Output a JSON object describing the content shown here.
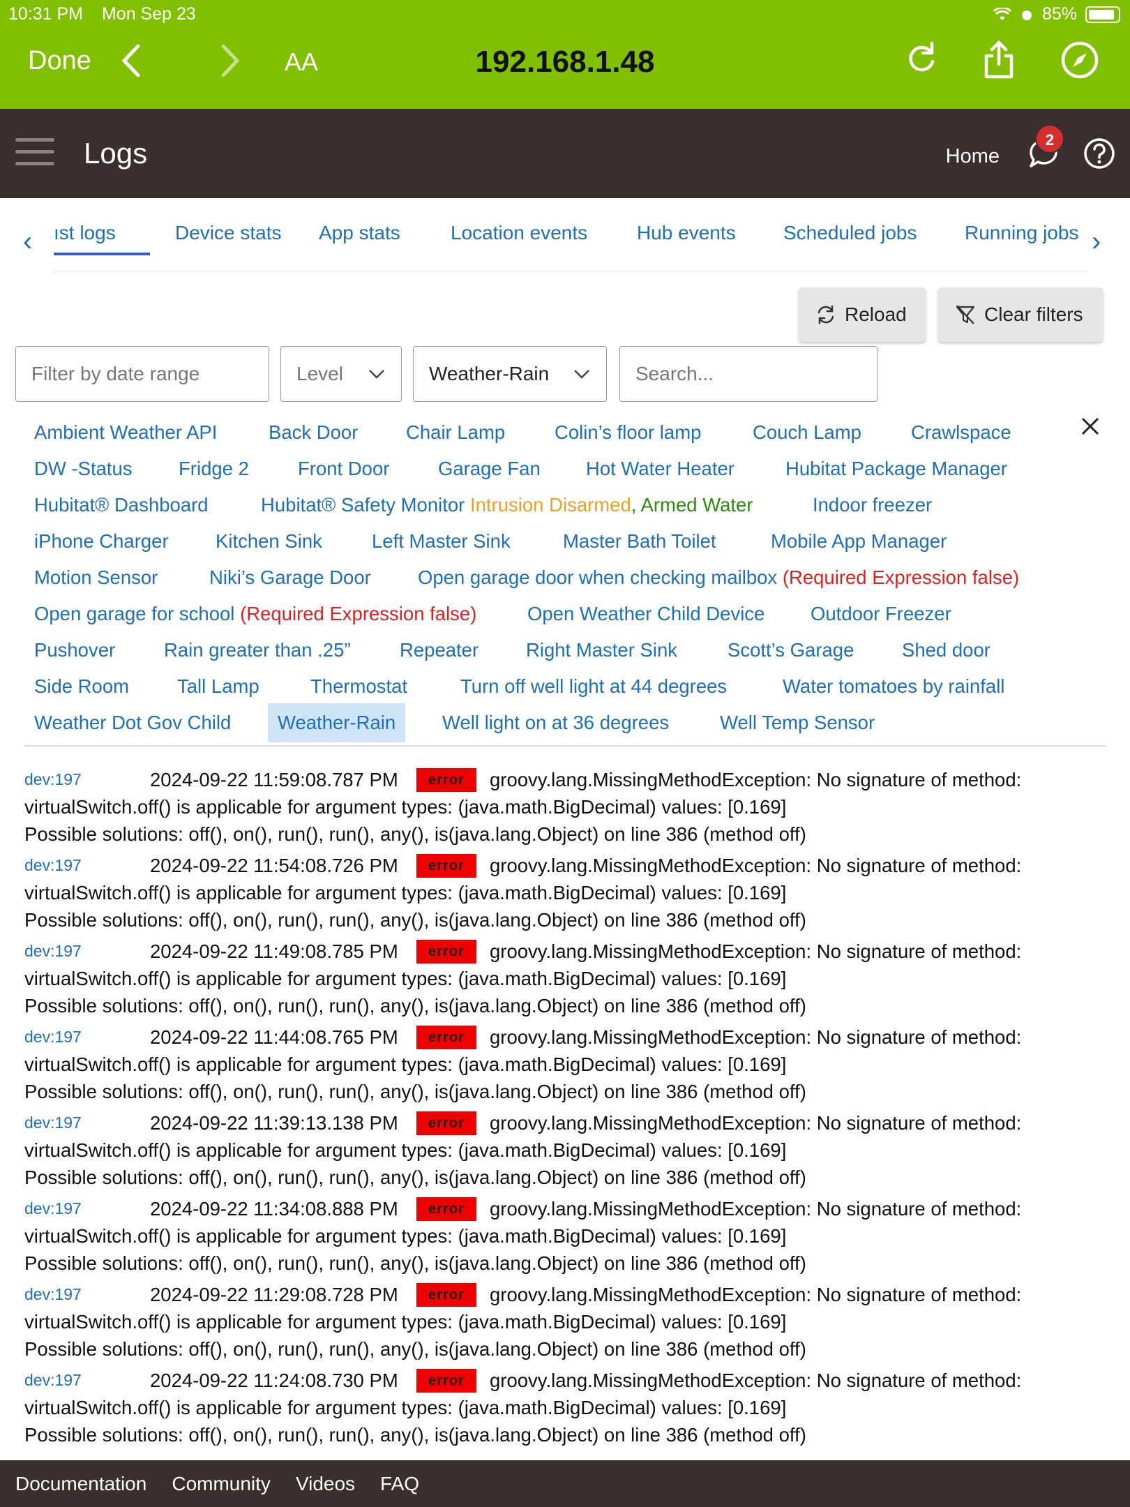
{
  "status_bar": {
    "time": "10:31 PM",
    "date": "Mon Sep 23",
    "battery": "85%"
  },
  "safari": {
    "done_label": "Done",
    "text_size_label": "AA",
    "url": "192.168.1.48"
  },
  "header": {
    "title": "Logs",
    "home_label": "Home",
    "notification_count": "2"
  },
  "tabs": [
    {
      "label": "ıst logs",
      "active": true
    },
    {
      "label": "Device stats"
    },
    {
      "label": "App stats"
    },
    {
      "label": "Location events"
    },
    {
      "label": "Hub events"
    },
    {
      "label": "Scheduled jobs"
    },
    {
      "label": "Running jobs"
    }
  ],
  "actions": {
    "reload_label": "Reload",
    "clear_label": "Clear filters"
  },
  "filters": {
    "date_placeholder": "Filter by date range",
    "level_placeholder": "Level",
    "device_value": "Weather-Rain",
    "search_placeholder": "Search..."
  },
  "devices": {
    "ambient": "Ambient Weather API",
    "back_door": "Back Door",
    "chair_lamp": "Chair Lamp",
    "colins_lamp": "Colin’s floor lamp",
    "couch_lamp": "Couch Lamp",
    "crawlspace": "Crawlspace",
    "dw_status": "DW -Status",
    "fridge2": "Fridge 2",
    "front_door": "Front Door",
    "garage_fan": "Garage Fan",
    "hot_water": "Hot Water Heater",
    "pkg_mgr": "Hubitat Package Manager",
    "dashboard": "Hubitat® Dashboard",
    "hsm": "Hubitat® Safety Monitor",
    "hsm_intrusion": "Intrusion Disarmed",
    "hsm_sep": ",",
    "hsm_water": "Armed Water",
    "indoor_freezer": "Indoor freezer",
    "iphone_charger": "iPhone Charger",
    "kitchen_sink": "Kitchen Sink",
    "left_master_sink": "Left Master Sink",
    "master_bath_toilet": "Master Bath Toilet",
    "mobile_app_mgr": "Mobile App Manager",
    "motion_sensor": "Motion Sensor",
    "nikis_garage": "Niki’s Garage Door",
    "open_garage_mailbox": "Open garage door when checking mailbox",
    "open_garage_mailbox_status": "(Required Expression false)",
    "open_garage_school": "Open garage for school",
    "open_garage_school_status": "(Required Expression false)",
    "owm_child": "Open Weather Child Device",
    "outdoor_freezer": "Outdoor Freezer",
    "pushover": "Pushover",
    "rain_gt": "Rain greater than .25”",
    "repeater": "Repeater",
    "right_master_sink": "Right Master Sink",
    "scotts_garage": "Scott’s Garage",
    "shed_door": "Shed door",
    "side_room": "Side Room",
    "tall_lamp": "Tall Lamp",
    "thermostat": "Thermostat",
    "well_off_44": "Turn off well light at 44 degrees",
    "water_tomatoes": "Water tomatoes by rainfall",
    "wdg_child": "Weather Dot Gov Child",
    "weather_rain": "Weather-Rain",
    "well_on_36": "Well light on at 36 degrees",
    "well_temp": "Well Temp Sensor"
  },
  "logs": [
    {
      "dev": "dev:197",
      "time": "2024-09-22 11:59:08.787 PM",
      "level": "error",
      "line1": "groovy.lang.MissingMethodException: No signature of method:",
      "line2": "virtualSwitch.off() is applicable for argument types: (java.math.BigDecimal) values: [0.169]",
      "line3": "Possible solutions: off(), on(), run(), run(), any(), is(java.lang.Object) on line 386 (method off)"
    },
    {
      "dev": "dev:197",
      "time": "2024-09-22 11:54:08.726 PM",
      "level": "error",
      "line1": "groovy.lang.MissingMethodException: No signature of method:",
      "line2": "virtualSwitch.off() is applicable for argument types: (java.math.BigDecimal) values: [0.169]",
      "line3": "Possible solutions: off(), on(), run(), run(), any(), is(java.lang.Object) on line 386 (method off)"
    },
    {
      "dev": "dev:197",
      "time": "2024-09-22 11:49:08.785 PM",
      "level": "error",
      "line1": "groovy.lang.MissingMethodException: No signature of method:",
      "line2": "virtualSwitch.off() is applicable for argument types: (java.math.BigDecimal) values: [0.169]",
      "line3": "Possible solutions: off(), on(), run(), run(), any(), is(java.lang.Object) on line 386 (method off)"
    },
    {
      "dev": "dev:197",
      "time": "2024-09-22 11:44:08.765 PM",
      "level": "error",
      "line1": "groovy.lang.MissingMethodException: No signature of method:",
      "line2": "virtualSwitch.off() is applicable for argument types: (java.math.BigDecimal) values: [0.169]",
      "line3": "Possible solutions: off(), on(), run(), run(), any(), is(java.lang.Object) on line 386 (method off)"
    },
    {
      "dev": "dev:197",
      "time": "2024-09-22 11:39:13.138 PM",
      "level": "error",
      "line1": "groovy.lang.MissingMethodException: No signature of method:",
      "line2": "virtualSwitch.off() is applicable for argument types: (java.math.BigDecimal) values: [0.169]",
      "line3": "Possible solutions: off(), on(), run(), run(), any(), is(java.lang.Object) on line 386 (method off)"
    },
    {
      "dev": "dev:197",
      "time": "2024-09-22 11:34:08.888 PM",
      "level": "error",
      "line1": "groovy.lang.MissingMethodException: No signature of method:",
      "line2": "virtualSwitch.off() is applicable for argument types: (java.math.BigDecimal) values: [0.169]",
      "line3": "Possible solutions: off(), on(), run(), run(), any(), is(java.lang.Object) on line 386 (method off)"
    },
    {
      "dev": "dev:197",
      "time": "2024-09-22 11:29:08.728 PM",
      "level": "error",
      "line1": "groovy.lang.MissingMethodException: No signature of method:",
      "line2": "virtualSwitch.off() is applicable for argument types: (java.math.BigDecimal) values: [0.169]",
      "line3": "Possible solutions: off(), on(), run(), run(), any(), is(java.lang.Object) on line 386 (method off)"
    },
    {
      "dev": "dev:197",
      "time": "2024-09-22 11:24:08.730 PM",
      "level": "error",
      "line1": "groovy.lang.MissingMethodException: No signature of method:",
      "line2": "virtualSwitch.off() is applicable for argument types: (java.math.BigDecimal) values: [0.169]",
      "line3": "Possible solutions: off(), on(), run(), run(), any(), is(java.lang.Object) on line 386 (method off)"
    }
  ],
  "footer": {
    "documentation": "Documentation",
    "community": "Community",
    "videos": "Videos",
    "faq": "FAQ"
  },
  "colors": {
    "safari_green": "#80c000",
    "app_bar": "#3a2f2d",
    "link_blue": "#1e6fb5",
    "error_red": "#ee0000",
    "selected_bg": "#cfe5f7"
  }
}
